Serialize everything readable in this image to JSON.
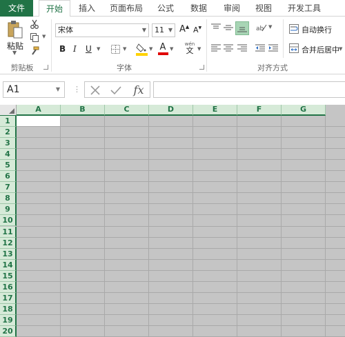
{
  "tabs": [
    "文件",
    "开始",
    "插入",
    "页面布局",
    "公式",
    "数据",
    "审阅",
    "视图",
    "开发工具"
  ],
  "active_tab": "开始",
  "ribbon": {
    "clipboard": {
      "paste_label": "粘贴",
      "group_label": "剪贴板"
    },
    "font": {
      "font_name": "宋体",
      "font_size": "11",
      "bold": "B",
      "italic": "I",
      "underline": "U",
      "increase_font": "A",
      "decrease_font": "A",
      "font_color_letter": "A",
      "phonetic_label": "wén",
      "phonetic_char": "文",
      "group_label": "字体"
    },
    "alignment": {
      "wrap_text": "自动换行",
      "merge_center": "合并后居中",
      "group_label": "对齐方式"
    }
  },
  "formula_bar": {
    "name_box": "A1",
    "fx": "fx",
    "formula": ""
  },
  "columns": [
    "A",
    "B",
    "C",
    "D",
    "E",
    "F",
    "G"
  ],
  "rows": [
    "1",
    "2",
    "3",
    "4",
    "5",
    "6",
    "7",
    "8",
    "9",
    "10",
    "11",
    "12",
    "13",
    "14",
    "15",
    "16",
    "17",
    "18",
    "19",
    "20"
  ],
  "active_cell": "A1",
  "colors": {
    "accent": "#217346",
    "header_bg": "#d6ead8",
    "selection_fill": "#c5c5c5",
    "gridline": "#a9a9a9",
    "highlight_yellow": "#ffd200",
    "font_red": "#e00000"
  }
}
